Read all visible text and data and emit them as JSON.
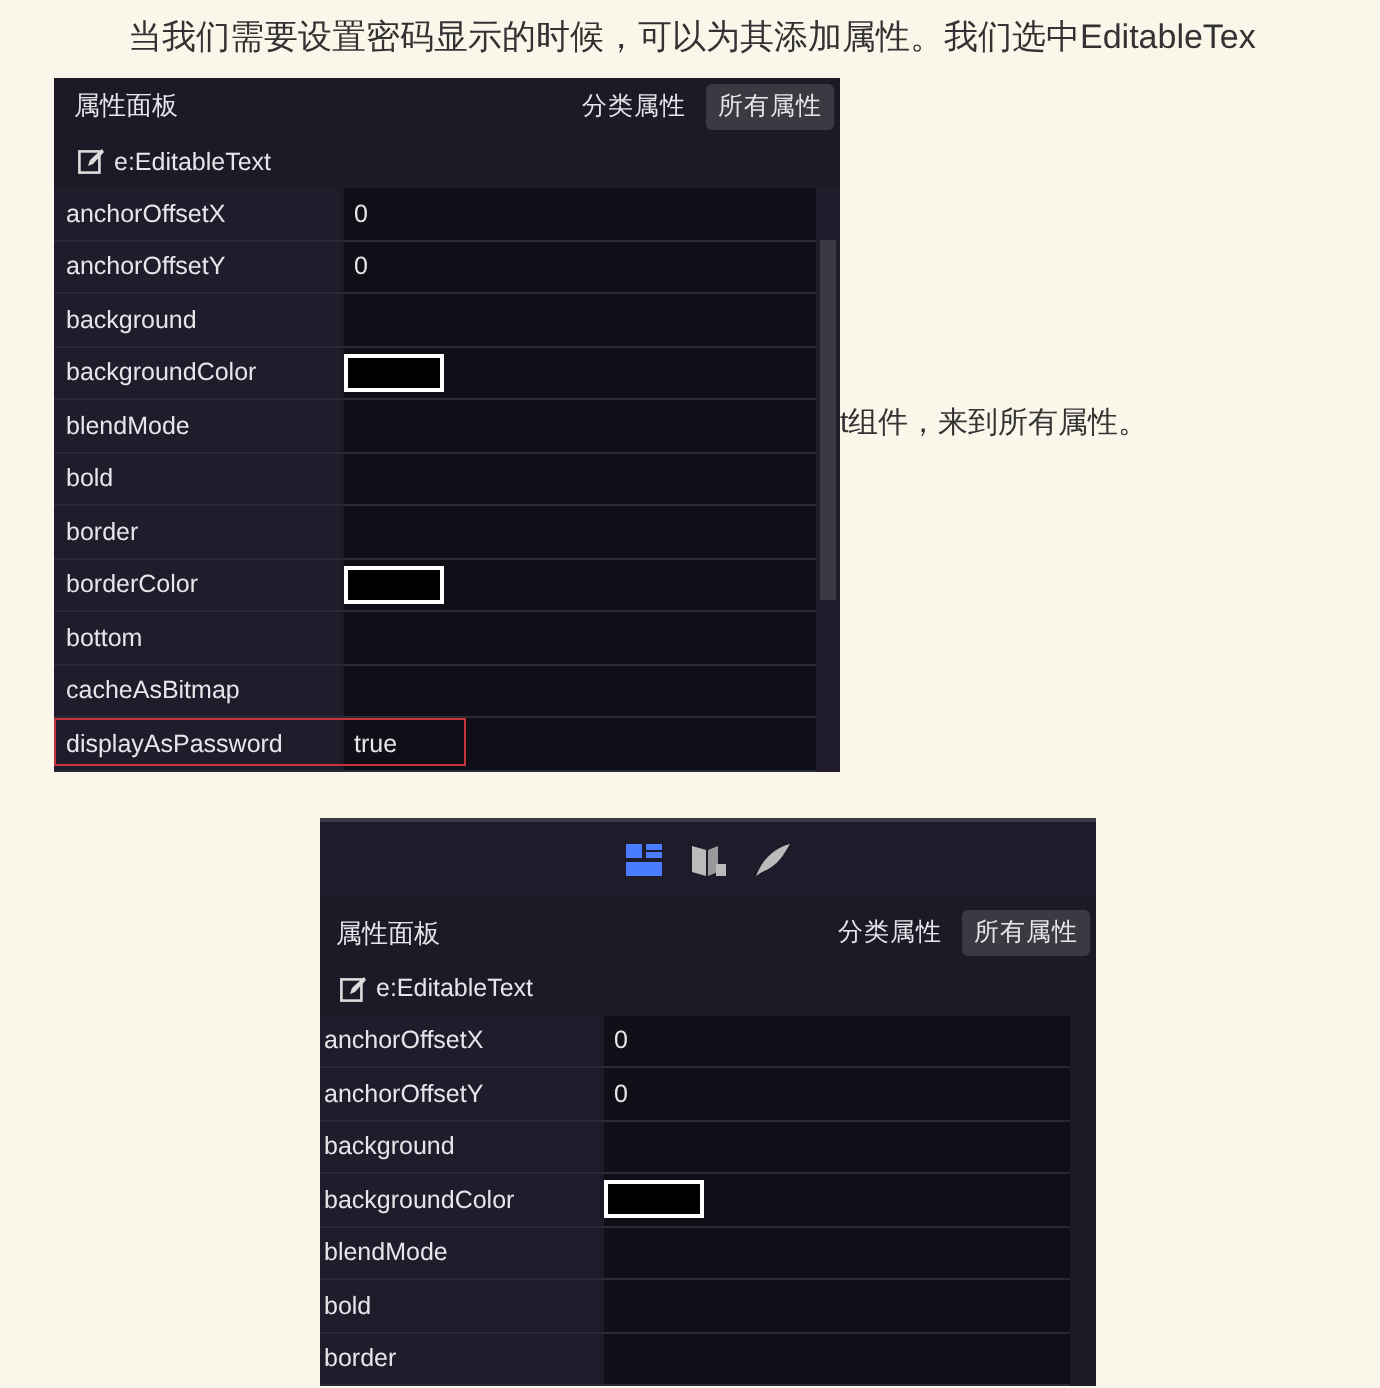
{
  "article": {
    "line": "当我们需要设置密码显示的时候，可以为其添加属性。我们选中EditableTex",
    "fragment": "t组件，来到所有属性。"
  },
  "panels": [
    {
      "scrollbar": true,
      "title": "属性面板",
      "tabs": [
        {
          "label": "分类属性",
          "selected": false
        },
        {
          "label": "所有属性",
          "selected": true
        }
      ],
      "object": "e:EditableText",
      "rows": [
        {
          "name": "anchorOffsetX",
          "kind": "text",
          "value": "0",
          "highlighted": false
        },
        {
          "name": "anchorOffsetY",
          "kind": "text",
          "value": "0",
          "highlighted": false
        },
        {
          "name": "background",
          "kind": "empty",
          "highlighted": false
        },
        {
          "name": "backgroundColor",
          "kind": "color",
          "highlighted": false
        },
        {
          "name": "blendMode",
          "kind": "empty",
          "highlighted": false
        },
        {
          "name": "bold",
          "kind": "empty",
          "highlighted": false
        },
        {
          "name": "border",
          "kind": "empty",
          "highlighted": false
        },
        {
          "name": "borderColor",
          "kind": "color",
          "highlighted": false
        },
        {
          "name": "bottom",
          "kind": "empty",
          "highlighted": false
        },
        {
          "name": "cacheAsBitmap",
          "kind": "empty",
          "highlighted": false
        },
        {
          "name": "displayAsPassword",
          "kind": "text",
          "value": "true",
          "highlighted": true
        }
      ]
    },
    {
      "toolbar": [
        {
          "kind": "layout",
          "selected": true
        },
        {
          "kind": "book",
          "selected": false
        },
        {
          "kind": "feather",
          "selected": false
        }
      ],
      "title": "属性面板",
      "tabs": [
        {
          "label": "分类属性",
          "selected": false
        },
        {
          "label": "所有属性",
          "selected": true
        }
      ],
      "object": "e:EditableText",
      "rows": [
        {
          "name": "anchorOffsetX",
          "kind": "text",
          "value": "0",
          "highlighted": false
        },
        {
          "name": "anchorOffsetY",
          "kind": "text",
          "value": "0",
          "highlighted": false
        },
        {
          "name": "background",
          "kind": "empty",
          "highlighted": false
        },
        {
          "name": "backgroundColor",
          "kind": "color",
          "highlighted": false
        },
        {
          "name": "blendMode",
          "kind": "empty",
          "highlighted": false
        },
        {
          "name": "bold",
          "kind": "empty",
          "highlighted": false
        },
        {
          "name": "border",
          "kind": "empty",
          "highlighted": false
        }
      ]
    }
  ]
}
